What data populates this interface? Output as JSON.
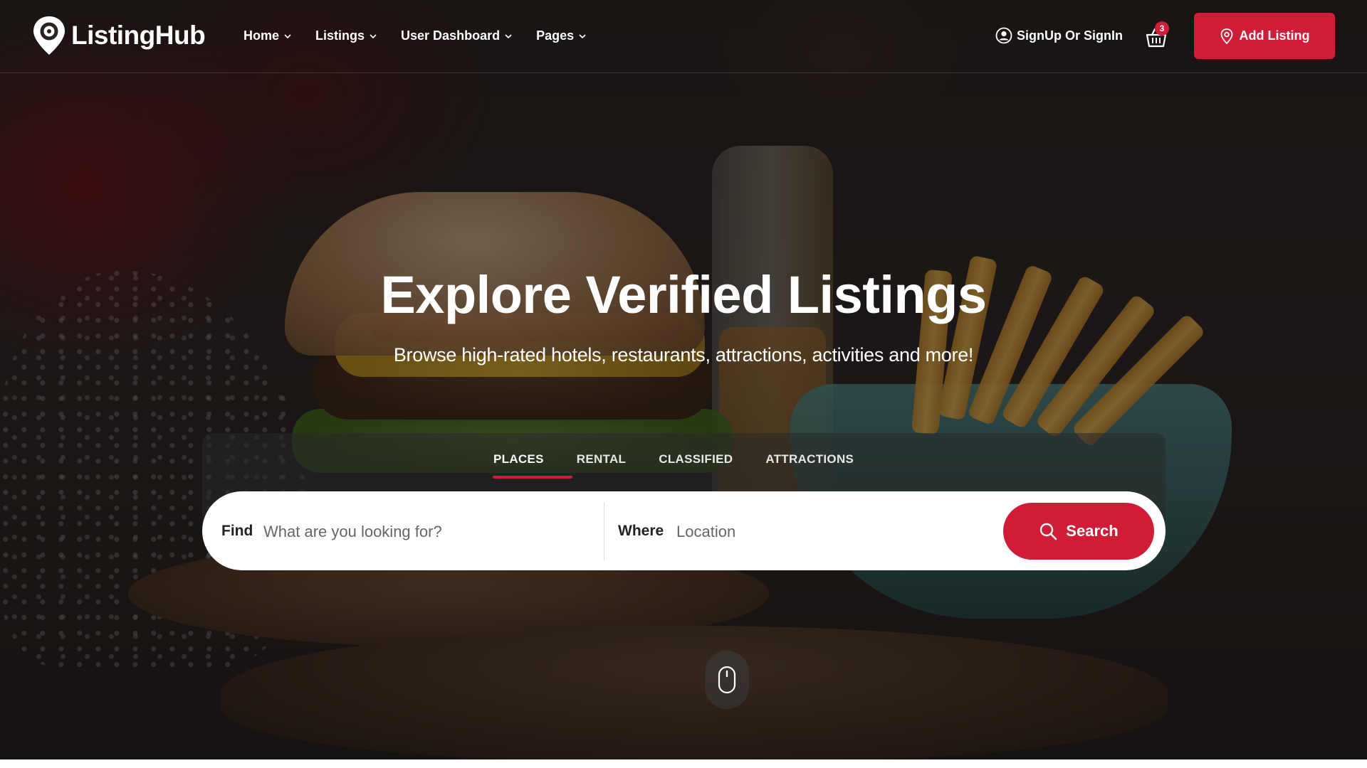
{
  "brand": {
    "name": "ListingHub"
  },
  "nav": {
    "items": [
      {
        "label": "Home"
      },
      {
        "label": "Listings"
      },
      {
        "label": "User Dashboard"
      },
      {
        "label": "Pages"
      }
    ]
  },
  "header": {
    "signin_label": "SignUp Or SignIn",
    "cart_count": "3",
    "add_listing_label": "Add Listing"
  },
  "hero": {
    "title": "Explore Verified Listings",
    "subtitle": "Browse high-rated hotels, restaurants, attractions, activities and more!"
  },
  "search": {
    "tabs": [
      {
        "label": "PLACES",
        "active": true
      },
      {
        "label": "RENTAL",
        "active": false
      },
      {
        "label": "CLASSIFIED",
        "active": false
      },
      {
        "label": "ATTRACTIONS",
        "active": false
      }
    ],
    "find_label": "Find",
    "find_placeholder": "What are you looking for?",
    "where_label": "Where",
    "where_placeholder": "Location",
    "button_label": "Search"
  },
  "colors": {
    "accent": "#d11c38",
    "overlay": "#1c1a18"
  },
  "icons": {
    "logo": "map-pin-logo-icon",
    "chevron": "chevron-down-icon",
    "user": "user-circle-icon",
    "cart": "shopping-basket-icon",
    "add": "location-pin-icon",
    "search": "search-icon",
    "scroll": "mouse-scroll-icon"
  }
}
